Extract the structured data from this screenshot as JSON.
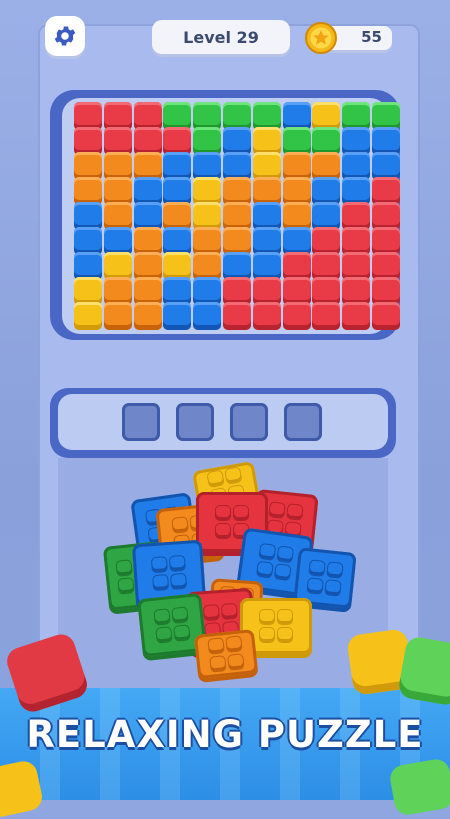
{
  "header": {
    "settings_icon": "gear-icon",
    "level_label": "Level 29",
    "coin_icon": "star-coin-icon",
    "coins": "55"
  },
  "board": {
    "rows": [
      [
        "red",
        "red",
        "red",
        "green",
        "green",
        "green",
        "green",
        "blue",
        "yellow",
        "green",
        "green"
      ],
      [
        "red",
        "red",
        "red",
        "red",
        "green",
        "blue",
        "yellow",
        "green",
        "green",
        "blue",
        "blue"
      ],
      [
        "orange",
        "orange",
        "orange",
        "blue",
        "blue",
        "blue",
        "yellow",
        "orange",
        "orange",
        "blue",
        "blue"
      ],
      [
        "orange",
        "orange",
        "blue",
        "blue",
        "yellow",
        "orange",
        "orange",
        "orange",
        "blue",
        "blue",
        "red"
      ],
      [
        "blue",
        "orange",
        "blue",
        "orange",
        "yellow",
        "orange",
        "blue",
        "orange",
        "blue",
        "red",
        "red"
      ],
      [
        "blue",
        "blue",
        "orange",
        "blue",
        "orange",
        "orange",
        "blue",
        "blue",
        "red",
        "red",
        "red"
      ],
      [
        "blue",
        "yellow",
        "orange",
        "yellow",
        "orange",
        "blue",
        "blue",
        "red",
        "red",
        "red",
        "red"
      ],
      [
        "yellow",
        "orange",
        "orange",
        "blue",
        "blue",
        "red",
        "red",
        "red",
        "red",
        "red",
        "red"
      ],
      [
        "yellow",
        "orange",
        "orange",
        "blue",
        "blue",
        "red",
        "red",
        "red",
        "red",
        "red",
        "red"
      ]
    ]
  },
  "slots": {
    "count": 4,
    "filled": 0
  },
  "pieces": [
    {
      "color": "yellow"
    },
    {
      "color": "blue"
    },
    {
      "color": "red"
    },
    {
      "color": "orange"
    },
    {
      "color": "red"
    },
    {
      "color": "blue"
    },
    {
      "color": "green"
    },
    {
      "color": "blue"
    },
    {
      "color": "blue"
    },
    {
      "color": "orange"
    },
    {
      "color": "red"
    },
    {
      "color": "green"
    },
    {
      "color": "yellow"
    },
    {
      "color": "orange"
    }
  ],
  "banner": {
    "text": "RELAXING PUZZLE"
  },
  "colors": {
    "frame": "#4a67c5",
    "background": "#8fa6e0",
    "banner": "#3a9cee"
  }
}
